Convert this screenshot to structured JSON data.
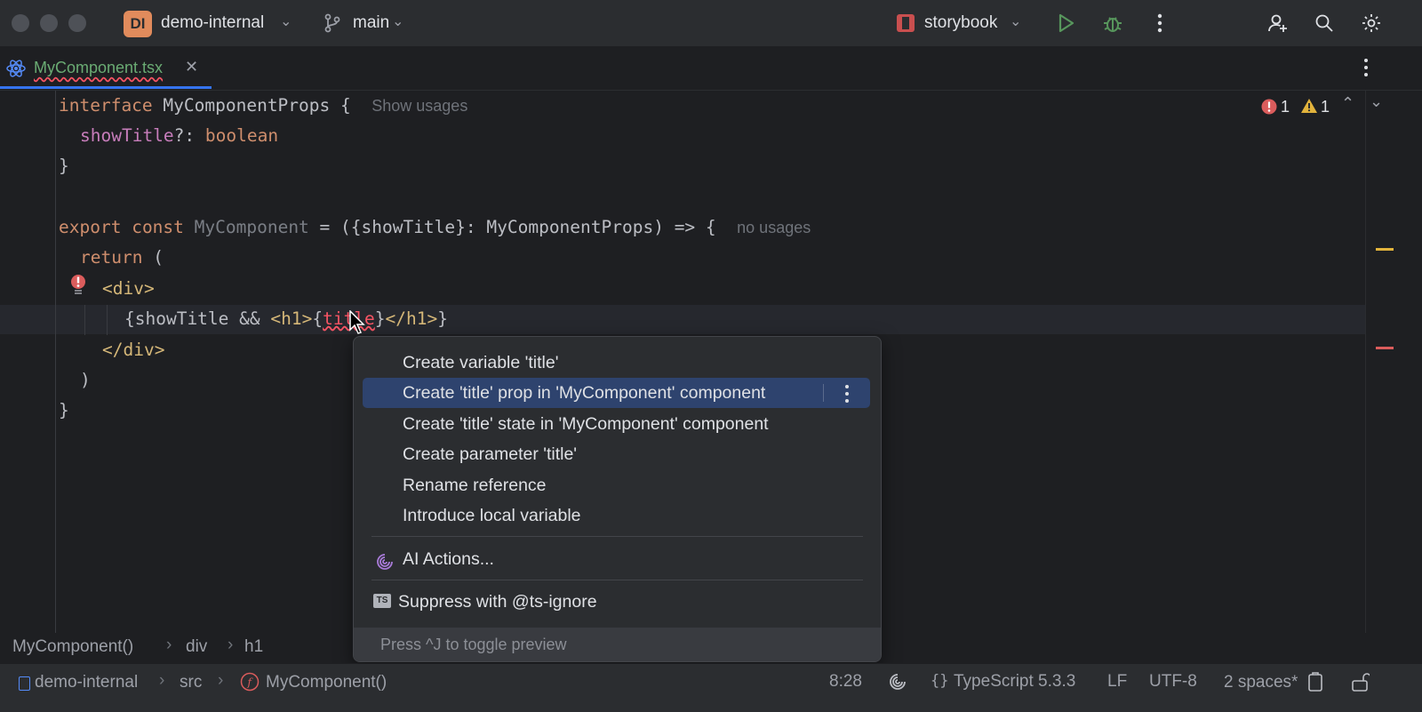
{
  "titlebar": {
    "project_badge": "DI",
    "project_name": "demo-internal",
    "branch_name": "main",
    "run_config": "storybook"
  },
  "tab": {
    "filename": "MyComponent.tsx"
  },
  "inspections": {
    "errors": "1",
    "warnings": "1"
  },
  "code": {
    "l1_kw": "interface",
    "l1_name": "MyComponentProps",
    "l1_brace": "{",
    "l1_hint": "Show usages",
    "l2_field": "showTitle",
    "l2_rest": "?: ",
    "l2_type": "boolean",
    "l3": "}",
    "l5_kw1": "export",
    "l5_kw2": "const",
    "l5_name": "MyComponent",
    "l5_rest": " = ({showTitle}: MyComponentProps) => {",
    "l5_hint": "no usages",
    "l6_kw": "return",
    "l6_rest": " (",
    "l7": "<div>",
    "l8_a": "{showTitle && ",
    "l8_b": "<h1>",
    "l8_c": "{",
    "l8_err": "title",
    "l8_d": "}",
    "l8_e": "</h1>",
    "l8_f": "}",
    "l9": "</div>",
    "l10": ")",
    "l11": "}"
  },
  "popup": {
    "items": [
      "Create variable 'title'",
      "Create 'title' prop in 'MyComponent' component",
      "Create 'title' state in 'MyComponent' component",
      "Create parameter 'title'",
      "Rename reference",
      "Introduce local variable"
    ],
    "ai_actions": "AI Actions...",
    "ts_badge": "TS",
    "suppress": "Suppress with @ts-ignore",
    "footer": "Press ^J to toggle preview"
  },
  "breadcrumb": [
    "MyComponent()",
    "div",
    "h1"
  ],
  "status": {
    "project": "demo-internal",
    "src": "src",
    "component": "MyComponent()",
    "position": "8:28",
    "language": "TypeScript 5.3.3",
    "line_sep": "LF",
    "encoding": "UTF-8",
    "indent": "2 spaces*"
  },
  "colors": {
    "accent": "#3574f0",
    "selection": "#2e436e",
    "error": "#f75464",
    "warning": "#e2b33c"
  }
}
